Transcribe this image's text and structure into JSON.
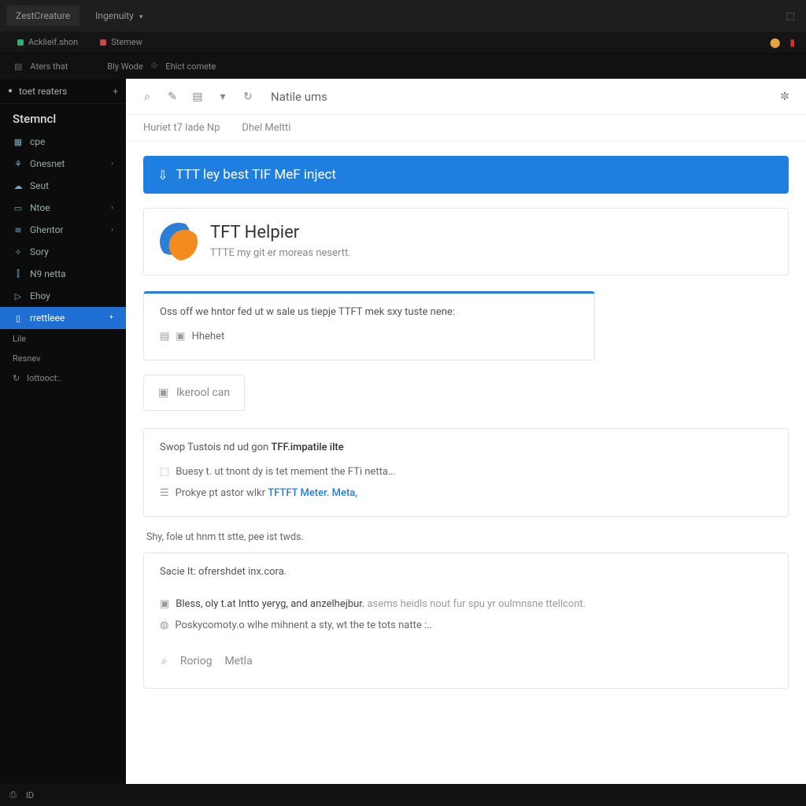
{
  "menubar": {
    "app_name": "ZestCreature",
    "items": [
      "Ingenuity"
    ],
    "right_icon": "thumb-up-icon"
  },
  "tabstrip": {
    "tabs": [
      {
        "label": "Acklieif.shon"
      },
      {
        "label": "Stemew"
      }
    ]
  },
  "crumb": {
    "a": "Aters that",
    "b": "Bly Wode",
    "c": "Ehlct comete"
  },
  "sidebar": {
    "toprow": {
      "label": "toet reaters",
      "plus": "+"
    },
    "heading": "Stemncl",
    "items": [
      {
        "icon": "grid-icon",
        "label": "cpe",
        "expandable": false
      },
      {
        "icon": "users-icon",
        "label": "Gnesnet",
        "expandable": true
      },
      {
        "icon": "cloud-icon",
        "label": "Seut",
        "expandable": false
      },
      {
        "icon": "note-icon",
        "label": "Ntoe",
        "expandable": true
      },
      {
        "icon": "chart-icon",
        "label": "Ghentor",
        "expandable": true
      },
      {
        "icon": "sparkle-icon",
        "label": "Sory",
        "expandable": false
      },
      {
        "icon": "bars-icon",
        "label": "N9 netta",
        "expandable": false
      },
      {
        "icon": "tag-icon",
        "label": "Ehoy",
        "expandable": false
      },
      {
        "icon": "bookmark-icon",
        "label": "rrettleee",
        "expandable": false,
        "active": true
      }
    ],
    "subs": [
      "Lile",
      "Resnev",
      "Iottooct:."
    ],
    "sub_icon": "clock-icon"
  },
  "toolbar": {
    "icons": [
      "search-icon",
      "pin-icon",
      "page-icon",
      "chevron-down-icon",
      "refresh-icon"
    ],
    "title": "Natile ums",
    "right_icon": "gear-icon"
  },
  "tabs2": {
    "a": "Huriet t7 lade Np",
    "b": "Dhel Meltti"
  },
  "banner": {
    "icon": "cloud-down-icon",
    "text": "TTT ley best TIF MeF inject"
  },
  "helper": {
    "title": "TFT Helpier",
    "subtitle": "TTTE my git er moreas nesertt."
  },
  "box1": {
    "lead": "Oss off we hntor fed ut w sale us tiepje TTFT mek sxy tuste nene:",
    "row_a": "Hhehet"
  },
  "smallbox": {
    "label": "lkerool can",
    "icon": "clipboard-icon"
  },
  "box2": {
    "lead_a": "Swop Tustois nd ud gon ",
    "lead_b": "TFF.impatile ilte",
    "row_a": "Buesy t. ut tnont dy is tet mement the FTi netta…",
    "row_b_a": "Prokye pt astor wlkr ",
    "row_b_b": "TFTFT Meter. Meta,"
  },
  "subhead": "Shy, fole ut hnm tt stte, pee ist twds.",
  "box3": {
    "lead": "Sacie It: ofrershdet inx.cora.",
    "row_a_strong": "Bless, oly t.at Intto yeryg, and anzelhejbur.",
    "row_a_rest": " asems heidls nout fur spu yr oulmnsne ttellcont.",
    "row_b": "Poskycomoty.o wlhe mihnent a sty, wt the te tots natte :.."
  },
  "footer": {
    "a": "Roriog",
    "b": "Metla"
  },
  "statusbar": {
    "a": "ID"
  }
}
